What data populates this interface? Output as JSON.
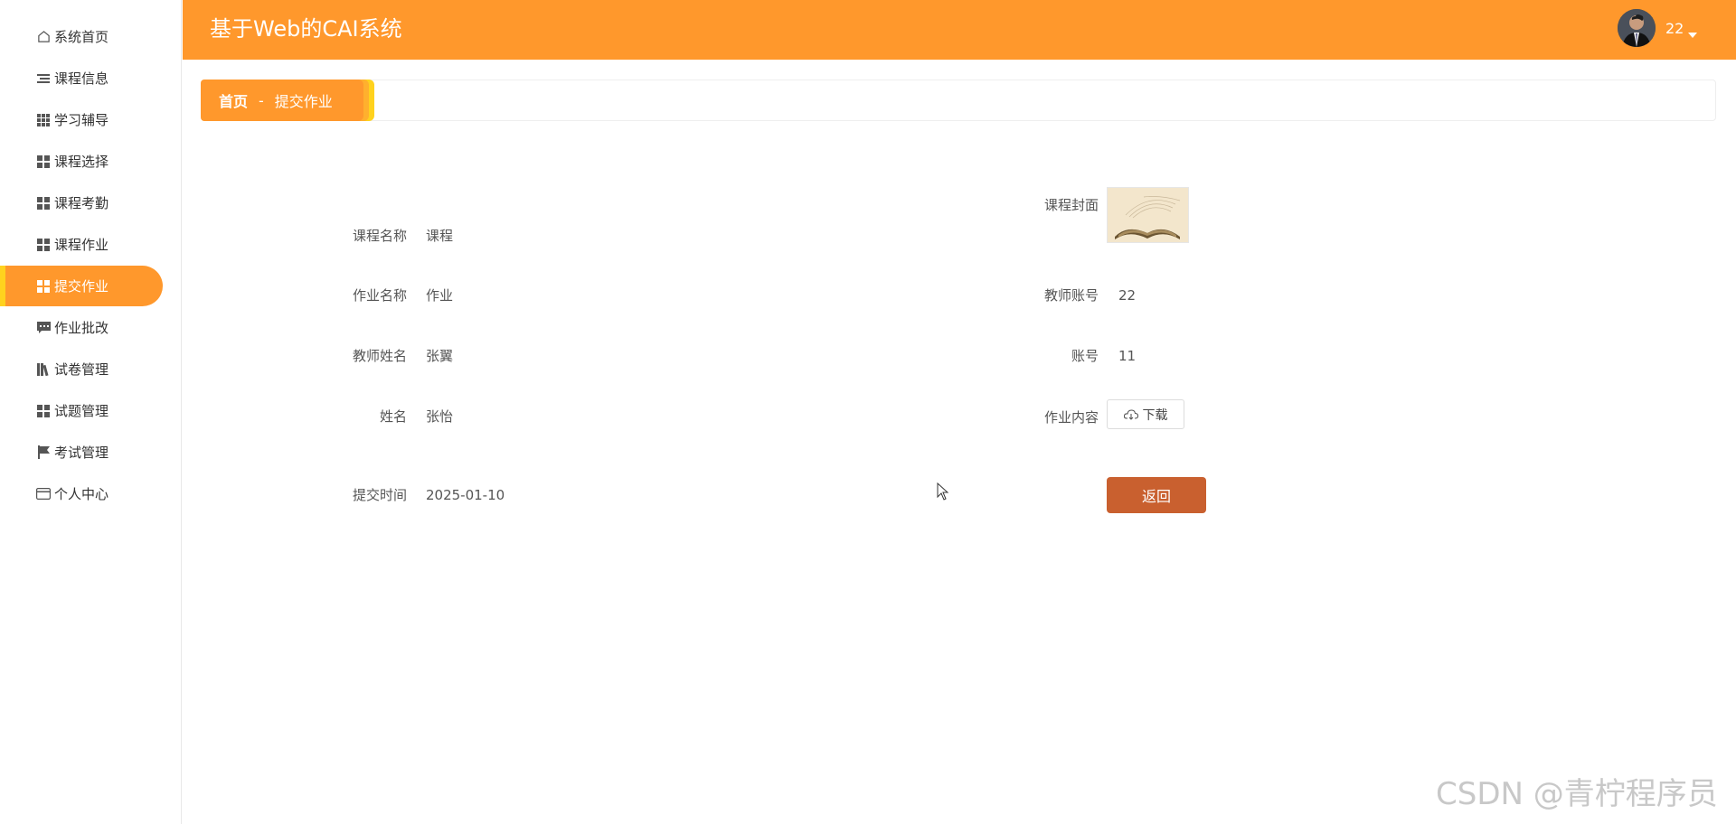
{
  "app": {
    "title": "基于Web的CAI系统",
    "username": "22"
  },
  "sidebar": {
    "items": [
      {
        "label": "系统首页",
        "icon": "home-icon"
      },
      {
        "label": "课程信息",
        "icon": "list-icon"
      },
      {
        "label": "学习辅导",
        "icon": "grid9-icon"
      },
      {
        "label": "课程选择",
        "icon": "grid4-icon"
      },
      {
        "label": "课程考勤",
        "icon": "grid4-icon"
      },
      {
        "label": "课程作业",
        "icon": "grid4-icon"
      },
      {
        "label": "提交作业",
        "icon": "grid4-icon",
        "active": true
      },
      {
        "label": "作业批改",
        "icon": "comment-icon"
      },
      {
        "label": "试卷管理",
        "icon": "library-icon"
      },
      {
        "label": "试题管理",
        "icon": "grid4-icon"
      },
      {
        "label": "考试管理",
        "icon": "flag-icon"
      },
      {
        "label": "个人中心",
        "icon": "card-icon"
      }
    ]
  },
  "breadcrumb": {
    "home": "首页",
    "separator": "-",
    "current": "提交作业"
  },
  "form": {
    "course_name_label": "课程名称",
    "course_name": "课程",
    "course_cover_label": "课程封面",
    "homework_name_label": "作业名称",
    "homework_name": "作业",
    "teacher_account_label": "教师账号",
    "teacher_account": "22",
    "teacher_name_label": "教师姓名",
    "teacher_name": "张翼",
    "account_label": "账号",
    "account": "11",
    "name_label": "姓名",
    "name": "张怡",
    "homework_content_label": "作业内容",
    "download_label": "下载",
    "submit_time_label": "提交时间",
    "submit_time": "2025-01-10",
    "back_label": "返回"
  },
  "watermark": "CSDN @青柠程序员",
  "colors": {
    "primary": "#ff982c",
    "accent": "#ffd21e",
    "back_button": "#c9602f"
  }
}
